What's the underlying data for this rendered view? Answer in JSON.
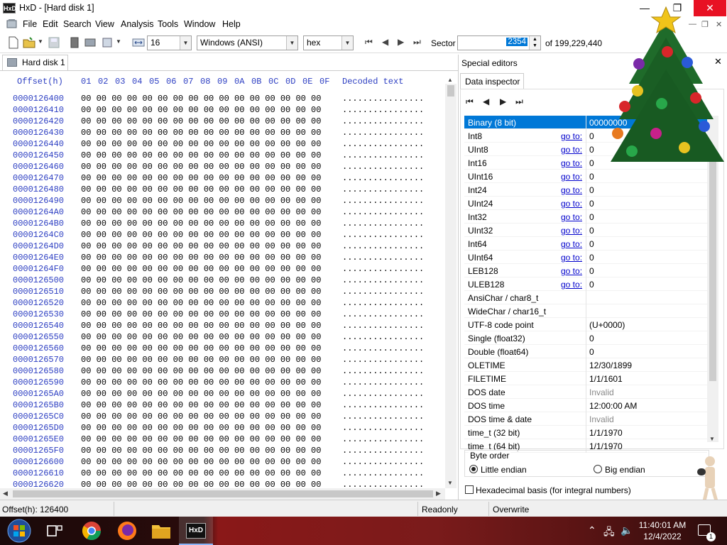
{
  "window": {
    "title": "HxD - [Hard disk 1]",
    "minimize": "—",
    "maximize": "❐",
    "close": "✕"
  },
  "menu": {
    "items": [
      "File",
      "Edit",
      "Search",
      "View",
      "Analysis",
      "Tools",
      "Window",
      "Help"
    ],
    "mdi_min": "—",
    "mdi_restore": "❐",
    "mdi_close": "✕"
  },
  "toolbar": {
    "bytes_per_row": "16",
    "charset": "Windows (ANSI)",
    "offset_base": "hex",
    "sector_label": "Sector",
    "sector_value": "2354",
    "sector_total": "of 199,229,440"
  },
  "document": {
    "tab_label": "Hard disk 1"
  },
  "hex": {
    "offset_header": "Offset(h)",
    "columns": [
      "01",
      "02",
      "03",
      "04",
      "05",
      "06",
      "07",
      "08",
      "09",
      "0A",
      "0B",
      "0C",
      "0D",
      "0E",
      "0F"
    ],
    "decoded_header": "Decoded text",
    "first_column": "00",
    "row_bytes": "00 00 00 00 00 00 00 00 00 00 00 00 00 00 00 00",
    "row_decoded": "................",
    "offsets": [
      "0000126400",
      "0000126410",
      "0000126420",
      "0000126430",
      "0000126440",
      "0000126450",
      "0000126460",
      "0000126470",
      "0000126480",
      "0000126490",
      "00001264A0",
      "00001264B0",
      "00001264C0",
      "00001264D0",
      "00001264E0",
      "00001264F0",
      "0000126500",
      "0000126510",
      "0000126520",
      "0000126530",
      "0000126540",
      "0000126550",
      "0000126560",
      "0000126570",
      "0000126580",
      "0000126590",
      "00001265A0",
      "00001265B0",
      "00001265C0",
      "00001265D0",
      "00001265E0",
      "00001265F0",
      "0000126600",
      "0000126610",
      "0000126620"
    ]
  },
  "panel": {
    "title": "Special editors",
    "close": "✕",
    "tab": "Data inspector",
    "goto_label": "go to:",
    "rows": [
      {
        "name": "Binary (8 bit)",
        "value": "00000000",
        "goto": false,
        "selected": true
      },
      {
        "name": "Int8",
        "value": "0",
        "goto": true
      },
      {
        "name": "UInt8",
        "value": "0",
        "goto": true
      },
      {
        "name": "Int16",
        "value": "0",
        "goto": true
      },
      {
        "name": "UInt16",
        "value": "0",
        "goto": true
      },
      {
        "name": "Int24",
        "value": "0",
        "goto": true
      },
      {
        "name": "UInt24",
        "value": "0",
        "goto": true
      },
      {
        "name": "Int32",
        "value": "0",
        "goto": true
      },
      {
        "name": "UInt32",
        "value": "0",
        "goto": true
      },
      {
        "name": "Int64",
        "value": "0",
        "goto": true
      },
      {
        "name": "UInt64",
        "value": "0",
        "goto": true
      },
      {
        "name": "LEB128",
        "value": "0",
        "goto": true
      },
      {
        "name": "ULEB128",
        "value": "0",
        "goto": true
      },
      {
        "name": "AnsiChar / char8_t",
        "value": "",
        "goto": false
      },
      {
        "name": "WideChar / char16_t",
        "value": "",
        "goto": false
      },
      {
        "name": "UTF-8 code point",
        "value": "  (U+0000)",
        "goto": false
      },
      {
        "name": "Single (float32)",
        "value": "0",
        "goto": false
      },
      {
        "name": "Double (float64)",
        "value": "0",
        "goto": false
      },
      {
        "name": "OLETIME",
        "value": "12/30/1899",
        "goto": false
      },
      {
        "name": "FILETIME",
        "value": "1/1/1601",
        "goto": false
      },
      {
        "name": "DOS date",
        "value": "Invalid",
        "goto": false,
        "gray": true
      },
      {
        "name": "DOS time",
        "value": "12:00:00 AM",
        "goto": false
      },
      {
        "name": "DOS time & date",
        "value": "Invalid",
        "goto": false,
        "gray": true
      },
      {
        "name": "time_t (32 bit)",
        "value": "1/1/1970",
        "goto": false
      },
      {
        "name": "time_t (64 bit)",
        "value": "1/1/1970",
        "goto": false
      }
    ],
    "byte_order_label": "Byte order",
    "little_endian": "Little endian",
    "big_endian": "Big endian",
    "hex_basis": "Hexadecimal basis (for integral numbers)"
  },
  "status": {
    "offset": "Offset(h): 126400",
    "readonly": "Readonly",
    "mode": "Overwrite"
  },
  "taskbar": {
    "time": "11:40:01 AM",
    "date": "12/4/2022",
    "notifications": "1"
  },
  "colors": {
    "offset_blue": "#2c3ec2",
    "selection": "#0078d7",
    "close_red": "#e81123"
  }
}
